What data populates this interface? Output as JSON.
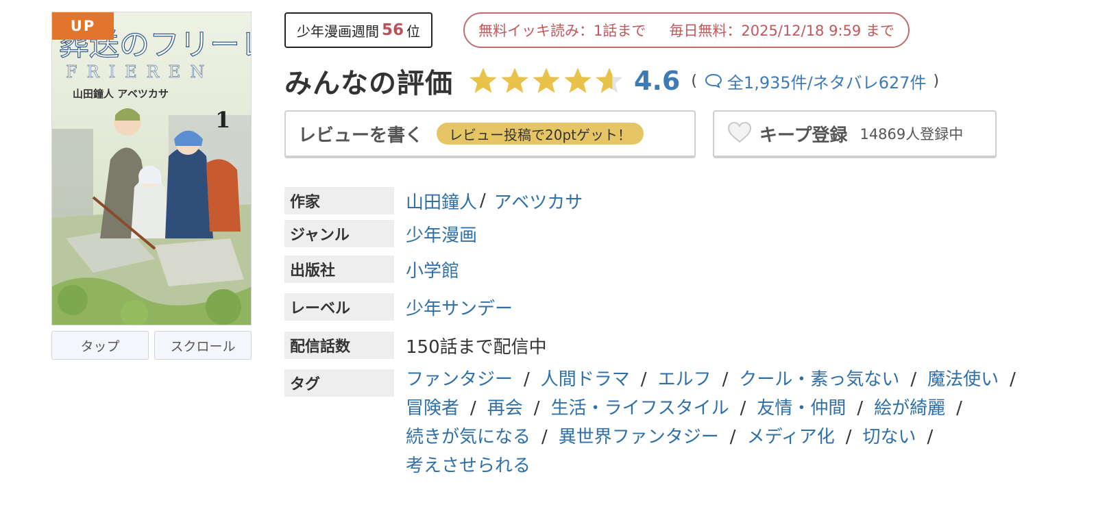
{
  "cover": {
    "badge": "UP",
    "title_art": "葬送のフリーレン",
    "title_romaji": "FRIEREN",
    "credits": "山田鐘人 アベツカサ",
    "volume": "1"
  },
  "view_modes": [
    "タップ",
    "スクロール"
  ],
  "rank": {
    "prefix": "少年漫画週間",
    "number": "56",
    "suffix": "位"
  },
  "free": {
    "ikki": "無料イッキ読み：1話まで",
    "daily": "毎日無料：2025/12/18 9:59 まで"
  },
  "rating": {
    "title": "みんなの評価",
    "score": "4.6",
    "value": 4.6,
    "max": 5,
    "open_paren": "(",
    "counts": "全1,935件/ネタバレ627件",
    "close_paren": ")"
  },
  "review": {
    "label": "レビューを書く",
    "promo": "レビュー投稿で20ptゲット！"
  },
  "keep": {
    "label": "キープ登録",
    "count": "14869人登録中"
  },
  "info": {
    "author_label": "作家",
    "authors": [
      "山田鐘人",
      "アベツカサ"
    ],
    "genre_label": "ジャンル",
    "genre": "少年漫画",
    "publisher_label": "出版社",
    "publisher": "小学館",
    "label_label": "レーベル",
    "label": "少年サンデー",
    "episodes_label": "配信話数",
    "episodes": "150話まで配信中",
    "tags_label": "タグ",
    "tags": [
      "ファンタジー",
      "人間ドラマ",
      "エルフ",
      "クール・素っ気ない",
      "魔法使い",
      "冒険者",
      "再会",
      "生活・ライフスタイル",
      "友情・仲間",
      "絵が綺麗",
      "続きが気になる",
      "異世界ファンタジー",
      "メディア化",
      "切ない",
      "考えさせられる"
    ]
  },
  "colors": {
    "accent_blue": "#3d7ab8",
    "star_gold": "#e9c24a",
    "badge_orange": "#e2752b",
    "free_red": "#c0585c",
    "promo_yellow": "#e6c565"
  }
}
